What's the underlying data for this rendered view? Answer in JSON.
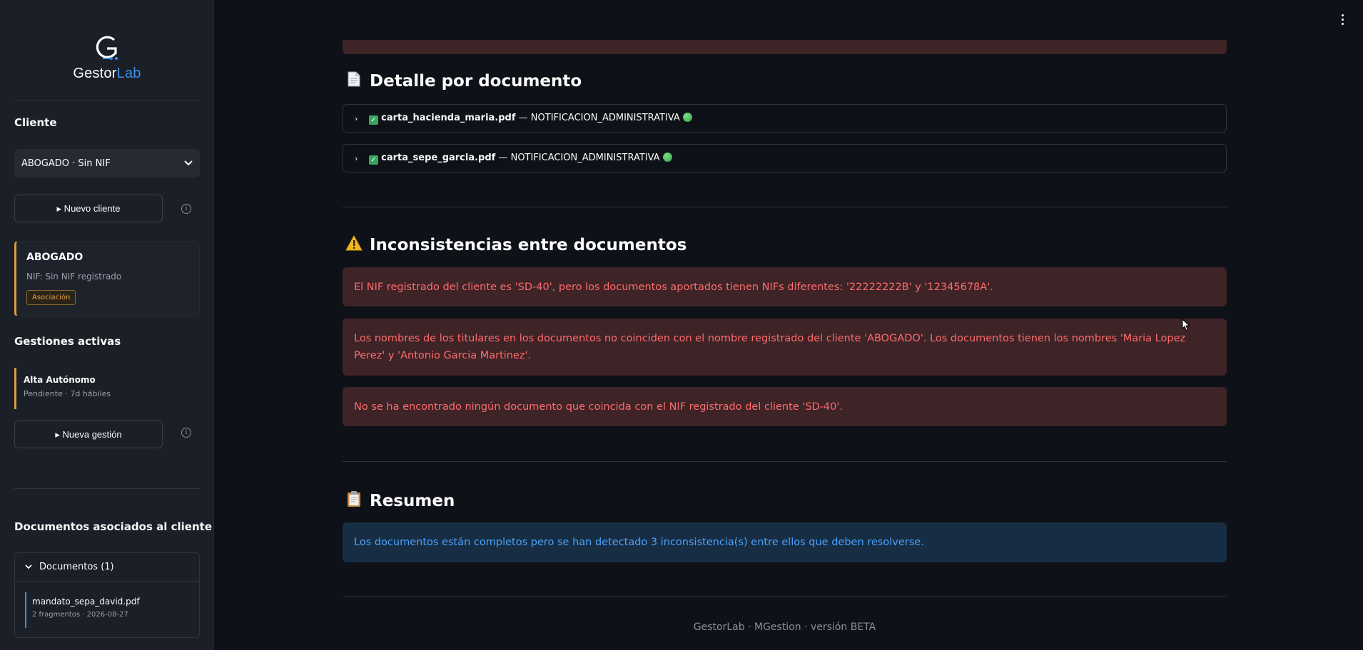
{
  "sidebar": {
    "logo": {
      "part1": "Gestor",
      "part2": "Lab",
      "accent": "#3d8ee8"
    },
    "client_heading": "Cliente",
    "client_select": {
      "value": "ABOGADO · Sin NIF"
    },
    "new_client_label": "▸ Nuevo cliente",
    "client_card": {
      "name": "ABOGADO",
      "nif": "NIF: Sin NIF registrado",
      "tag": "Asociación"
    },
    "gestiones_heading": "Gestiones activas",
    "gestion": {
      "title": "Alta Autónomo",
      "status": "Pendiente · 7d hábiles"
    },
    "new_gestion_label": "▸ Nueva gestión",
    "docs_heading": "Documentos asociados al cliente",
    "docs_expander": "Documentos (1)",
    "doc": {
      "name": "mandato_sepa_david.pdf",
      "meta": "2 fragmentos · 2026-08-27"
    }
  },
  "main": {
    "detalle_title": "Detalle por documento",
    "documents": [
      {
        "file": "carta_hacienda_maria.pdf",
        "type": " — NOTIFICACION_ADMINISTRATIVA"
      },
      {
        "file": "carta_sepe_garcia.pdf",
        "type": " — NOTIFICACION_ADMINISTRATIVA"
      }
    ],
    "inconsistencias_title": "Inconsistencias entre documentos",
    "errors": [
      "El NIF registrado del cliente es 'SD-40', pero los documentos aportados tienen NIFs diferentes: '22222222B' y '12345678A'.",
      "Los nombres de los titulares en los documentos no coinciden con el nombre registrado del cliente 'ABOGADO'. Los documentos tienen los nombres 'Maria Lopez Perez' y 'Antonio Garcia Martinez'.",
      "No se ha encontrado ningún documento que coincida con el NIF registrado del cliente 'SD-40'."
    ],
    "resumen_title": "Resumen",
    "resumen_text": "Los documentos están completos pero se han detectado 3 inconsistencia(s) entre ellos que deben resolverse.",
    "footer": "GestorLab · MGestion · versión BETA"
  },
  "colors": {
    "error_bg": "#3e2327",
    "error_text": "#ff6b6b",
    "info_bg": "#172d43",
    "info_text": "#4aa3ff",
    "pending": "#d9a03a"
  },
  "icons": [
    "document-icon",
    "warning-icon",
    "clipboard-icon",
    "chevron-right-icon",
    "check-icon",
    "green-dot-icon",
    "info-icon",
    "kebab-menu-icon"
  ]
}
